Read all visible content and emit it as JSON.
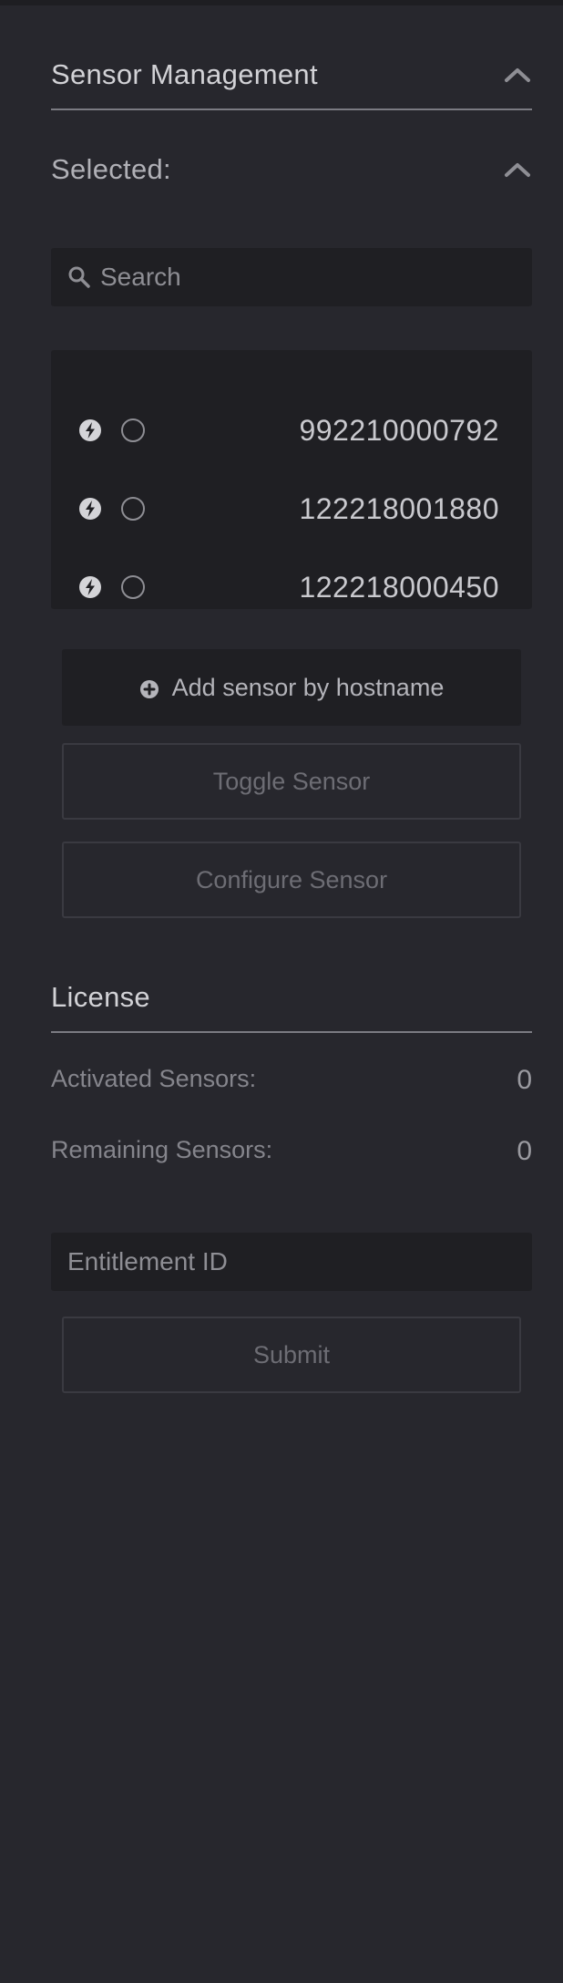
{
  "sensor_management": {
    "title": "Sensor Management",
    "selected_label": "Selected:",
    "search": {
      "placeholder": "Search",
      "value": ""
    },
    "sensors": [
      {
        "id": "992210000792",
        "icon": "bolt-icon",
        "selected": false
      },
      {
        "id": "122218001880",
        "icon": "bolt-icon",
        "selected": false
      },
      {
        "id": "122218000450",
        "icon": "bolt-icon",
        "selected": false
      }
    ],
    "add_button_label": "Add sensor by hostname",
    "toggle_button_label": "Toggle Sensor",
    "configure_button_label": "Configure Sensor"
  },
  "license": {
    "title": "License",
    "activated_label": "Activated Sensors:",
    "activated_value": "0",
    "remaining_label": "Remaining Sensors:",
    "remaining_value": "0",
    "entitlement": {
      "placeholder": "Entitlement ID",
      "value": ""
    },
    "submit_label": "Submit"
  },
  "colors": {
    "background": "#27272d",
    "panel": "#1f1f23",
    "text": "#c7c7cc",
    "muted": "#85858c",
    "rule": "#7b7b82"
  }
}
